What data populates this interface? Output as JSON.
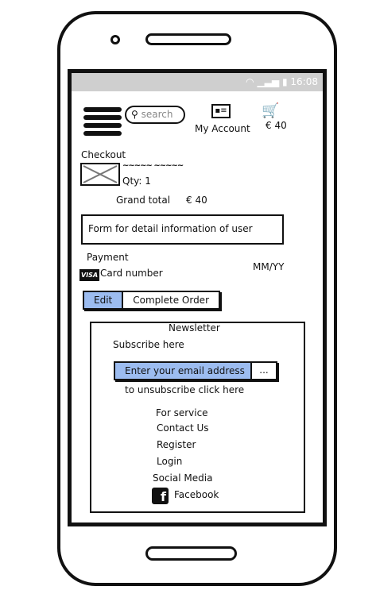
{
  "status_bar": {
    "time": "16:08"
  },
  "header": {
    "search_placeholder": "search",
    "my_account": "My Account",
    "cart_total": "€ 40"
  },
  "checkout": {
    "title": "Checkout",
    "item_name": "~~~~~ ~~~~~",
    "qty": "Qty: 1",
    "grand_total_label": "Grand total",
    "grand_total_value": "€ 40"
  },
  "form": {
    "text": "Form for detail information of user"
  },
  "payment": {
    "title": "Payment",
    "card_brand": "VISA",
    "card_number": "Card number",
    "expiry": "MM/YY"
  },
  "actions": {
    "edit": "Edit",
    "complete": "Complete Order"
  },
  "newsletter": {
    "title": "Newsletter",
    "subscribe": "Subscribe here",
    "email_placeholder": "Enter your email address",
    "submit": "...",
    "unsubscribe": "to unsubscribe click here"
  },
  "footer": {
    "items": [
      "For service",
      "Contact Us",
      "Register",
      "Login",
      "Social Media"
    ],
    "facebook": "Facebook"
  },
  "colors": {
    "accent": "#9cbcf0",
    "status_bar": "#cfcfcf"
  }
}
